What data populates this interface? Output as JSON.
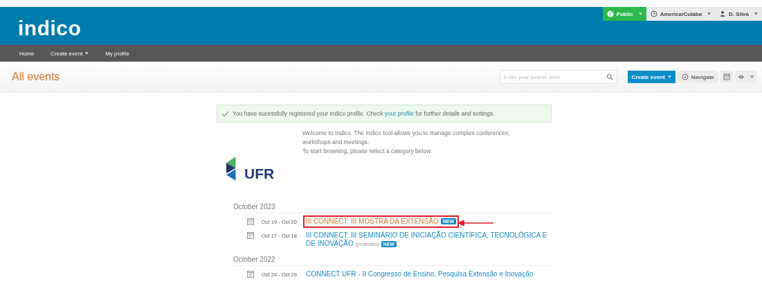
{
  "header": {
    "logo": "indico",
    "public_button": "Public",
    "timezone_button": "America/Cuiaba",
    "user_button": "D. Silva",
    "menus_dropdown": true
  },
  "nav": [
    {
      "label": "Home",
      "dropdown": false
    },
    {
      "label": "Create event",
      "dropdown": true
    },
    {
      "label": "My profile",
      "dropdown": false
    }
  ],
  "title_bar": {
    "title": "All events",
    "search": {
      "placeholder": "Enter your search term"
    },
    "create_button": "Create event",
    "create_dropdown": true,
    "navigate_button": "Navigate",
    "view_dropdown": true
  },
  "message": {
    "before": "You have sucessfully registered your Indico profile. Check ",
    "link": "your profile",
    "after": " for further details and settings."
  },
  "welcome": [
    "Welcome to Indico. The Indico tool allows you to manage complex conferences, workshops and meetings.",
    "To start browsing, please select a category below."
  ],
  "logo": {
    "text": "UFR"
  },
  "months": [
    {
      "title": "October 2023",
      "events": [
        {
          "dates": "Oct 19 - Oct 20",
          "title": "III CONNECT: III MOSTRA DA EXTENSÃO",
          "badge": "NEW",
          "highlighted": true
        },
        {
          "dates": "Oct 17 - Oct 18",
          "title": "III CONNECT: III SEMINÁRIO DE INICIAÇÃO CIENTÍFICA, TECNOLÓGICA E DE INOVAÇÃO",
          "protected": "(protected)",
          "badge": "NEW",
          "highlighted": false
        }
      ]
    },
    {
      "title": "October 2022",
      "events": [
        {
          "dates": "Oct 24 - Oct 29",
          "title": "CONNECT UFR - II Congresso de Ensino, Pesquisa Extensão e Inovação",
          "highlighted": false
        }
      ]
    }
  ]
}
